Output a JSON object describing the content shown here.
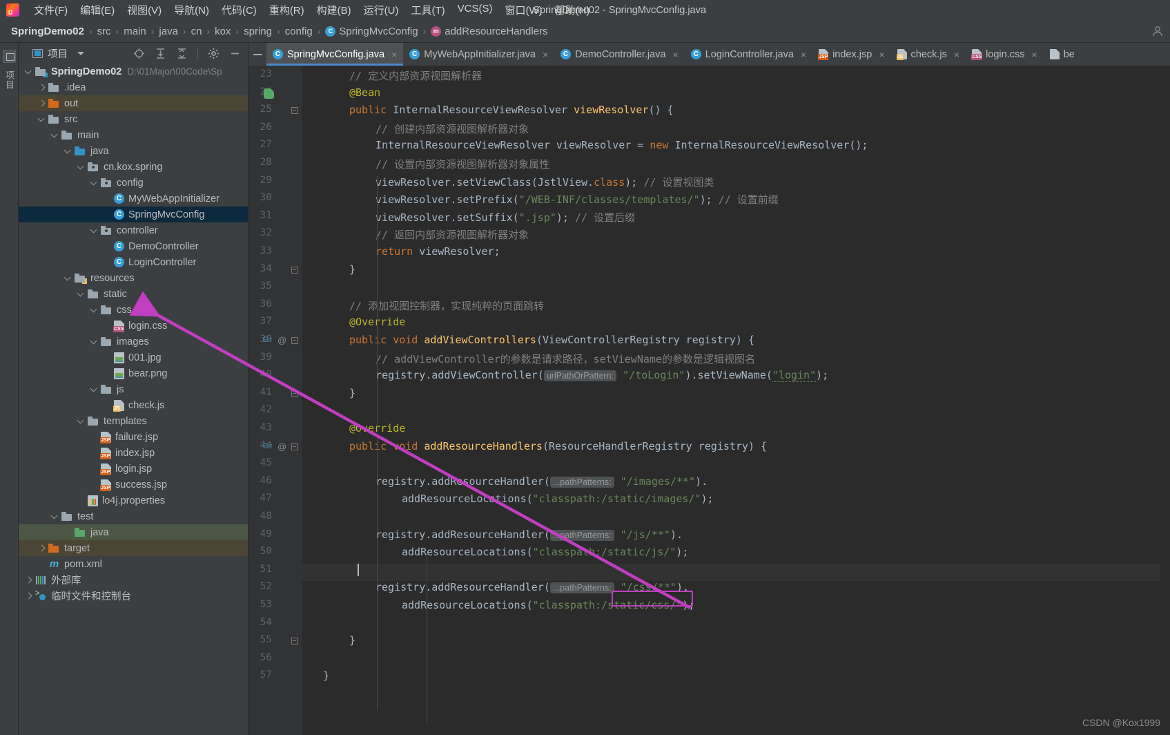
{
  "window": {
    "title": "SpringDemo02 - SpringMvcConfig.java"
  },
  "menubar": {
    "logo": "intellij-idea-logo",
    "items": [
      {
        "label": "文件(F)",
        "name": "menu-file"
      },
      {
        "label": "编辑(E)",
        "name": "menu-edit"
      },
      {
        "label": "视图(V)",
        "name": "menu-view"
      },
      {
        "label": "导航(N)",
        "name": "menu-navigate"
      },
      {
        "label": "代码(C)",
        "name": "menu-code"
      },
      {
        "label": "重构(R)",
        "name": "menu-refactor"
      },
      {
        "label": "构建(B)",
        "name": "menu-build"
      },
      {
        "label": "运行(U)",
        "name": "menu-run"
      },
      {
        "label": "工具(T)",
        "name": "menu-tools"
      },
      {
        "label": "VCS(S)",
        "name": "menu-vcs"
      },
      {
        "label": "窗口(W)",
        "name": "menu-window"
      },
      {
        "label": "帮助(H)",
        "name": "menu-help"
      }
    ]
  },
  "breadcrumb": {
    "separator": "›",
    "items": [
      {
        "label": "SpringDemo02",
        "icon": "",
        "bold": true
      },
      {
        "label": "src",
        "icon": "",
        "bold": false
      },
      {
        "label": "main",
        "icon": "",
        "bold": false
      },
      {
        "label": "java",
        "icon": "",
        "bold": false
      },
      {
        "label": "cn",
        "icon": "",
        "bold": false
      },
      {
        "label": "kox",
        "icon": "",
        "bold": false
      },
      {
        "label": "spring",
        "icon": "",
        "bold": false
      },
      {
        "label": "config",
        "icon": "",
        "bold": false
      },
      {
        "label": "SpringMvcConfig",
        "icon": "class-icon",
        "bold": false
      },
      {
        "label": "addResourceHandlers",
        "icon": "method-icon",
        "bold": false
      }
    ]
  },
  "tool_stripe": {
    "label": "项目"
  },
  "project_panel": {
    "title": "项目",
    "tools": [
      "locate-icon",
      "expand-all-icon",
      "collapse-all-icon",
      "settings-icon",
      "hide-icon"
    ],
    "tree": [
      {
        "label": "SpringDemo02",
        "path": "D:\\01Major\\00Code\\Sp",
        "depth": 0,
        "arrow": "down",
        "icon": "module-folder-icon",
        "style": "bold",
        "row": ""
      },
      {
        "label": ".idea",
        "path": "",
        "depth": 1,
        "arrow": "right",
        "icon": "folder-gray-icon",
        "style": "",
        "row": ""
      },
      {
        "label": "out",
        "path": "",
        "depth": 1,
        "arrow": "right",
        "icon": "folder-orange-icon",
        "style": "",
        "row": "hl-brown"
      },
      {
        "label": "src",
        "path": "",
        "depth": 1,
        "arrow": "down",
        "icon": "folder-gray-icon",
        "style": "",
        "row": ""
      },
      {
        "label": "main",
        "path": "",
        "depth": 2,
        "arrow": "down",
        "icon": "folder-gray-icon",
        "style": "",
        "row": ""
      },
      {
        "label": "java",
        "path": "",
        "depth": 3,
        "arrow": "down",
        "icon": "folder-blue-icon",
        "style": "",
        "row": ""
      },
      {
        "label": "cn.kox.spring",
        "path": "",
        "depth": 4,
        "arrow": "down",
        "icon": "package-icon",
        "style": "",
        "row": ""
      },
      {
        "label": "config",
        "path": "",
        "depth": 5,
        "arrow": "down",
        "icon": "package-icon",
        "style": "",
        "row": ""
      },
      {
        "label": "MyWebAppInitializer",
        "path": "",
        "depth": 6,
        "arrow": "none",
        "icon": "class-icon",
        "style": "",
        "row": ""
      },
      {
        "label": "SpringMvcConfig",
        "path": "",
        "depth": 6,
        "arrow": "none",
        "icon": "class-icon",
        "style": "",
        "row": "sel-blue"
      },
      {
        "label": "controller",
        "path": "",
        "depth": 5,
        "arrow": "down",
        "icon": "package-icon",
        "style": "",
        "row": ""
      },
      {
        "label": "DemoController",
        "path": "",
        "depth": 6,
        "arrow": "none",
        "icon": "class-icon",
        "style": "",
        "row": ""
      },
      {
        "label": "LoginController",
        "path": "",
        "depth": 6,
        "arrow": "none",
        "icon": "class-icon",
        "style": "",
        "row": ""
      },
      {
        "label": "resources",
        "path": "",
        "depth": 3,
        "arrow": "down",
        "icon": "resources-folder-icon",
        "style": "",
        "row": ""
      },
      {
        "label": "static",
        "path": "",
        "depth": 4,
        "arrow": "down",
        "icon": "folder-gray-icon",
        "style": "",
        "row": ""
      },
      {
        "label": "css",
        "path": "",
        "depth": 5,
        "arrow": "down",
        "icon": "folder-gray-icon",
        "style": "",
        "row": ""
      },
      {
        "label": "login.css",
        "path": "",
        "depth": 6,
        "arrow": "none",
        "icon": "css-file-icon",
        "style": "",
        "row": ""
      },
      {
        "label": "images",
        "path": "",
        "depth": 5,
        "arrow": "down",
        "icon": "folder-gray-icon",
        "style": "",
        "row": ""
      },
      {
        "label": "001.jpg",
        "path": "",
        "depth": 6,
        "arrow": "none",
        "icon": "image-file-icon",
        "style": "",
        "row": ""
      },
      {
        "label": "bear.png",
        "path": "",
        "depth": 6,
        "arrow": "none",
        "icon": "image-file-icon",
        "style": "",
        "row": ""
      },
      {
        "label": "js",
        "path": "",
        "depth": 5,
        "arrow": "down",
        "icon": "folder-gray-icon",
        "style": "",
        "row": ""
      },
      {
        "label": "check.js",
        "path": "",
        "depth": 6,
        "arrow": "none",
        "icon": "js-file-icon",
        "style": "",
        "row": ""
      },
      {
        "label": "templates",
        "path": "",
        "depth": 4,
        "arrow": "down",
        "icon": "folder-gray-icon",
        "style": "",
        "row": ""
      },
      {
        "label": "failure.jsp",
        "path": "",
        "depth": 5,
        "arrow": "none",
        "icon": "jsp-file-icon",
        "style": "",
        "row": ""
      },
      {
        "label": "index.jsp",
        "path": "",
        "depth": 5,
        "arrow": "none",
        "icon": "jsp-file-icon",
        "style": "",
        "row": ""
      },
      {
        "label": "login.jsp",
        "path": "",
        "depth": 5,
        "arrow": "none",
        "icon": "jsp-file-icon",
        "style": "",
        "row": ""
      },
      {
        "label": "success.jsp",
        "path": "",
        "depth": 5,
        "arrow": "none",
        "icon": "jsp-file-icon",
        "style": "",
        "row": ""
      },
      {
        "label": "lo4j.properties",
        "path": "",
        "depth": 4,
        "arrow": "none",
        "icon": "properties-file-icon",
        "style": "",
        "row": ""
      },
      {
        "label": "test",
        "path": "",
        "depth": 2,
        "arrow": "down",
        "icon": "folder-gray-icon",
        "style": "",
        "row": ""
      },
      {
        "label": "java",
        "path": "",
        "depth": 3,
        "arrow": "none",
        "icon": "folder-green-icon",
        "style": "",
        "row": "hl-green"
      },
      {
        "label": "target",
        "path": "",
        "depth": 1,
        "arrow": "right",
        "icon": "folder-orange-icon",
        "style": "",
        "row": "hl-brown"
      },
      {
        "label": "pom.xml",
        "path": "",
        "depth": 1,
        "arrow": "none",
        "icon": "maven-icon",
        "style": "",
        "row": ""
      },
      {
        "label": "外部库",
        "path": "",
        "depth": 0,
        "arrow": "right",
        "icon": "library-icon",
        "style": "",
        "row": ""
      },
      {
        "label": "临时文件和控制台",
        "path": "",
        "depth": 0,
        "arrow": "right",
        "icon": "scratches-icon",
        "style": "",
        "row": ""
      }
    ]
  },
  "editor_tabs": [
    {
      "label": "SpringMvcConfig.java",
      "icon": "class-icon",
      "active": true,
      "close": "×"
    },
    {
      "label": "MyWebAppInitializer.java",
      "icon": "class-icon",
      "active": false,
      "close": "×"
    },
    {
      "label": "DemoController.java",
      "icon": "class-icon",
      "active": false,
      "close": "×"
    },
    {
      "label": "LoginController.java",
      "icon": "class-icon",
      "active": false,
      "close": "×"
    },
    {
      "label": "index.jsp",
      "icon": "jsp-file-icon",
      "active": false,
      "close": "×"
    },
    {
      "label": "check.js",
      "icon": "js-file-icon",
      "active": false,
      "close": "×"
    },
    {
      "label": "login.css",
      "icon": "css-file-icon",
      "active": false,
      "close": "×"
    },
    {
      "label": "be",
      "icon": "file-icon",
      "active": false,
      "close": ""
    }
  ],
  "editor": {
    "first_line": 23,
    "last_line": 57,
    "current_line": 51,
    "lines": [
      {
        "n": 23,
        "indent": 1,
        "tokens": [
          {
            "t": "// 定义内部资源视图解析器",
            "c": "cm"
          }
        ]
      },
      {
        "n": 24,
        "indent": 1,
        "tokens": [
          {
            "t": "@Bean",
            "c": "an"
          }
        ],
        "marker": "bean"
      },
      {
        "n": 25,
        "indent": 1,
        "tokens": [
          {
            "t": "public ",
            "c": "k"
          },
          {
            "t": "InternalResourceViewResolver ",
            "c": "ty"
          },
          {
            "t": "viewResolver",
            "c": "fn"
          },
          {
            "t": "() {",
            "c": "ty"
          }
        ],
        "fold": true
      },
      {
        "n": 26,
        "indent": 2,
        "tokens": [
          {
            "t": "// 创建内部资源视图解析器对象",
            "c": "cm"
          }
        ]
      },
      {
        "n": 27,
        "indent": 2,
        "tokens": [
          {
            "t": "InternalResourceViewResolver viewResolver = ",
            "c": "ty"
          },
          {
            "t": "new ",
            "c": "k"
          },
          {
            "t": "InternalResourceViewResolver();",
            "c": "ty"
          }
        ]
      },
      {
        "n": 28,
        "indent": 2,
        "tokens": [
          {
            "t": "// 设置内部资源视图解析器对象属性",
            "c": "cm"
          }
        ]
      },
      {
        "n": 29,
        "indent": 2,
        "tokens": [
          {
            "t": "viewResolver.setViewClass(JstlView.",
            "c": "ty"
          },
          {
            "t": "class",
            "c": "k"
          },
          {
            "t": "); ",
            "c": "ty"
          },
          {
            "t": "// 设置视图类",
            "c": "cm"
          }
        ]
      },
      {
        "n": 30,
        "indent": 2,
        "tokens": [
          {
            "t": "viewResolver.setPrefix(",
            "c": "ty"
          },
          {
            "t": "\"/WEB-INF/classes/templates/\"",
            "c": "st"
          },
          {
            "t": "); ",
            "c": "ty"
          },
          {
            "t": "// 设置前缀",
            "c": "cm"
          }
        ]
      },
      {
        "n": 31,
        "indent": 2,
        "tokens": [
          {
            "t": "viewResolver.setSuffix(",
            "c": "ty"
          },
          {
            "t": "\".jsp\"",
            "c": "st"
          },
          {
            "t": "); ",
            "c": "ty"
          },
          {
            "t": "// 设置后缀",
            "c": "cm"
          }
        ]
      },
      {
        "n": 32,
        "indent": 2,
        "tokens": [
          {
            "t": "// 返回内部资源视图解析器对象",
            "c": "cm"
          }
        ]
      },
      {
        "n": 33,
        "indent": 2,
        "tokens": [
          {
            "t": "return ",
            "c": "k"
          },
          {
            "t": "viewResolver;",
            "c": "ty"
          }
        ]
      },
      {
        "n": 34,
        "indent": 1,
        "tokens": [
          {
            "t": "}",
            "c": "ty"
          }
        ],
        "fold": true
      },
      {
        "n": 35,
        "indent": 0,
        "tokens": []
      },
      {
        "n": 36,
        "indent": 1,
        "tokens": [
          {
            "t": "// 添加视图控制器，实现纯粹的页面跳转",
            "c": "cm"
          }
        ]
      },
      {
        "n": 37,
        "indent": 1,
        "tokens": [
          {
            "t": "@Override",
            "c": "an"
          }
        ]
      },
      {
        "n": 38,
        "indent": 1,
        "tokens": [
          {
            "t": "public void ",
            "c": "k"
          },
          {
            "t": "addViewControllers",
            "c": "fn"
          },
          {
            "t": "(ViewControllerRegistry registry) {",
            "c": "ty"
          }
        ],
        "fold": true,
        "marker": "override"
      },
      {
        "n": 39,
        "indent": 2,
        "tokens": [
          {
            "t": "// addViewController的参数是请求路径，setViewName的参数是逻辑视图名",
            "c": "cm"
          }
        ]
      },
      {
        "n": 40,
        "indent": 2,
        "tokens": [
          {
            "t": "registry.addViewController(",
            "c": "ty"
          },
          {
            "t": "urlPathOrPattern:",
            "c": "hint"
          },
          {
            "t": "\"/toLogin\"",
            "c": "st"
          },
          {
            "t": ").setViewName(",
            "c": "ty"
          },
          {
            "t": "\"login\"",
            "c": "st-u"
          },
          {
            "t": ");",
            "c": "ty"
          }
        ]
      },
      {
        "n": 41,
        "indent": 1,
        "tokens": [
          {
            "t": "}",
            "c": "ty"
          }
        ],
        "fold": true
      },
      {
        "n": 42,
        "indent": 0,
        "tokens": []
      },
      {
        "n": 43,
        "indent": 1,
        "tokens": [
          {
            "t": "@Override",
            "c": "an"
          }
        ]
      },
      {
        "n": 44,
        "indent": 1,
        "tokens": [
          {
            "t": "public void ",
            "c": "k"
          },
          {
            "t": "addResourceHandlers",
            "c": "fn"
          },
          {
            "t": "(ResourceHandlerRegistry registry) {",
            "c": "ty"
          }
        ],
        "fold": true,
        "marker": "override"
      },
      {
        "n": 45,
        "indent": 0,
        "tokens": []
      },
      {
        "n": 46,
        "indent": 2,
        "tokens": [
          {
            "t": "registry.addResourceHandler(",
            "c": "ty"
          },
          {
            "t": "...pathPatterns:",
            "c": "hint"
          },
          {
            "t": "\"/images/**\"",
            "c": "st"
          },
          {
            "t": ").",
            "c": "ty"
          }
        ]
      },
      {
        "n": 47,
        "indent": 3,
        "tokens": [
          {
            "t": "addResourceLocations(",
            "c": "ty"
          },
          {
            "t": "\"classpath:/static/images/\"",
            "c": "st"
          },
          {
            "t": ");",
            "c": "ty"
          }
        ]
      },
      {
        "n": 48,
        "indent": 0,
        "tokens": []
      },
      {
        "n": 49,
        "indent": 2,
        "tokens": [
          {
            "t": "registry.addResourceHandler(",
            "c": "ty"
          },
          {
            "t": "...pathPatterns:",
            "c": "hint"
          },
          {
            "t": "\"/js/**\"",
            "c": "st"
          },
          {
            "t": ").",
            "c": "ty"
          }
        ]
      },
      {
        "n": 50,
        "indent": 3,
        "tokens": [
          {
            "t": "addResourceLocations(",
            "c": "ty"
          },
          {
            "t": "\"classpath:/static/js/\"",
            "c": "st"
          },
          {
            "t": ");",
            "c": "ty"
          }
        ]
      },
      {
        "n": 51,
        "indent": 0,
        "tokens": [],
        "caret": true
      },
      {
        "n": 52,
        "indent": 2,
        "tokens": [
          {
            "t": "registry.addResourceHandler(",
            "c": "ty"
          },
          {
            "t": "...pathPatterns:",
            "c": "hint"
          },
          {
            "t": "\"/css/**\"",
            "c": "st"
          },
          {
            "t": ").",
            "c": "ty"
          }
        ]
      },
      {
        "n": 53,
        "indent": 3,
        "tokens": [
          {
            "t": "addResourceLocations(",
            "c": "ty"
          },
          {
            "t": "\"classpath:",
            "c": "st"
          },
          {
            "t": "/static/css/\"",
            "c": "st-box"
          },
          {
            "t": ");",
            "c": "ty"
          }
        ]
      },
      {
        "n": 54,
        "indent": 0,
        "tokens": []
      },
      {
        "n": 55,
        "indent": 1,
        "tokens": [
          {
            "t": "}",
            "c": "ty"
          }
        ],
        "fold": true
      },
      {
        "n": 56,
        "indent": 0,
        "tokens": []
      },
      {
        "n": 57,
        "indent": 0,
        "tokens": [
          {
            "t": "}",
            "c": "ty"
          }
        ]
      }
    ]
  },
  "annotation": {
    "arrow_color": "#c03fc0",
    "highlight_box_target": "/static/css/"
  },
  "watermark": "CSDN @Kox1999"
}
